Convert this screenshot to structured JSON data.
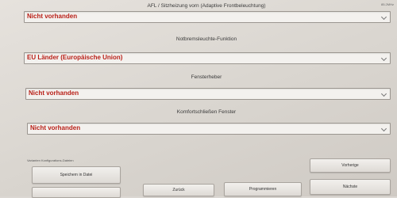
{
  "header": {
    "corner_text": "85.2MHz"
  },
  "fields": [
    {
      "label": "AFL / Sitzheizung vorn (Adaptive Frontbeleuchtung)",
      "value": "Nicht vorhanden"
    },
    {
      "label": "Notbremsleuchte-Funktion",
      "value": "EU Länder (Europäische Union)"
    },
    {
      "label": "Fensterheber",
      "value": "Nicht vorhanden"
    },
    {
      "label": "Komfortschließen Fenster",
      "value": "Nicht vorhanden"
    }
  ],
  "footer": {
    "section_label": "Varianten Konfigurations-Dateien",
    "save_label": "Speichern in Datei",
    "back_label": "Zurück",
    "program_label": "Programmieren",
    "previous_label": "Vorherige",
    "next_label": "Nächste"
  },
  "colors": {
    "value_text": "#b81e16"
  }
}
